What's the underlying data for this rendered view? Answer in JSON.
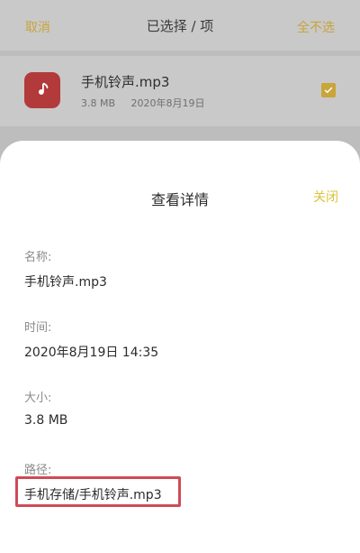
{
  "header": {
    "left_label": "取消",
    "title": "已选择 / 项",
    "right_label": "全不选"
  },
  "file": {
    "name": "手机铃声.mp3",
    "size": "3.8 MB",
    "date": "2020年8月19日",
    "checked": true,
    "icon": "music-note-icon",
    "icon_color": "#b33a3a"
  },
  "sheet": {
    "title": "查看详情",
    "close_label": "关闭",
    "fields": {
      "name_label": "名称:",
      "name_value": "手机铃声.mp3",
      "time_label": "时间:",
      "time_value": "2020年8月19日 14:35",
      "size_label": "大小:",
      "size_value": "3.8 MB",
      "path_label": "路径:",
      "path_value": "手机存储/手机铃声.mp3"
    }
  },
  "colors": {
    "accent": "#c9a53a",
    "highlight": "#d04a57"
  }
}
